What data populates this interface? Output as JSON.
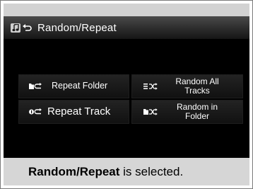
{
  "screen": {
    "title": "Random/Repeat",
    "title_icons": [
      "music-note-icon",
      "back-arrow-icon"
    ]
  },
  "menu": {
    "repeat_folder": {
      "label": "Repeat Folder",
      "icon": "folder-repeat-icon"
    },
    "random_all_tracks": {
      "line1": "Random All",
      "line2": "Tracks",
      "icon": "list-shuffle-icon"
    },
    "repeat_track": {
      "label": "Repeat Track",
      "icon": "track-repeat-icon"
    },
    "random_in_folder": {
      "line1": "Random in",
      "line2": "Folder",
      "icon": "folder-shuffle-icon"
    }
  },
  "caption": {
    "bold": "Random/Repeat",
    "rest": " is selected."
  }
}
